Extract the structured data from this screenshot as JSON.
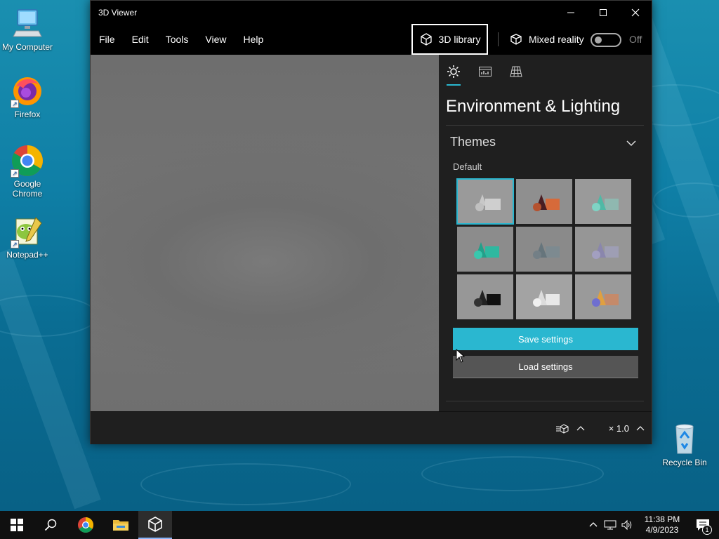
{
  "desktop": {
    "icons": [
      {
        "label": "My Computer"
      },
      {
        "label": "Firefox"
      },
      {
        "label": "Google Chrome"
      },
      {
        "label": "Notepad++"
      },
      {
        "label": "Recycle Bin"
      }
    ]
  },
  "window": {
    "title": "3D Viewer",
    "controls": {
      "minimize": "minimize-icon",
      "maximize": "maximize-icon",
      "close": "close-icon"
    }
  },
  "menubar": {
    "items": [
      "File",
      "Edit",
      "Tools",
      "View",
      "Help"
    ],
    "library_label": "3D library",
    "mixed_reality_label": "Mixed reality",
    "mixed_reality_state": "Off"
  },
  "panel": {
    "title": "Environment & Lighting",
    "tabs": [
      "lighting-icon",
      "stats-icon",
      "grid-icon"
    ],
    "themes_header": "Themes",
    "themes_group": "Default",
    "theme_count": 9,
    "selected_theme": 0,
    "save_label": "Save settings",
    "load_label": "Load settings"
  },
  "statusbar": {
    "speed": "× 1.0"
  },
  "taskbar": {
    "time": "11:38 PM",
    "date": "4/9/2023",
    "notification_count": "1"
  },
  "colors": {
    "accent": "#2ab7d0",
    "window_bg": "#1f1f1f",
    "titlebar_bg": "#000000"
  }
}
